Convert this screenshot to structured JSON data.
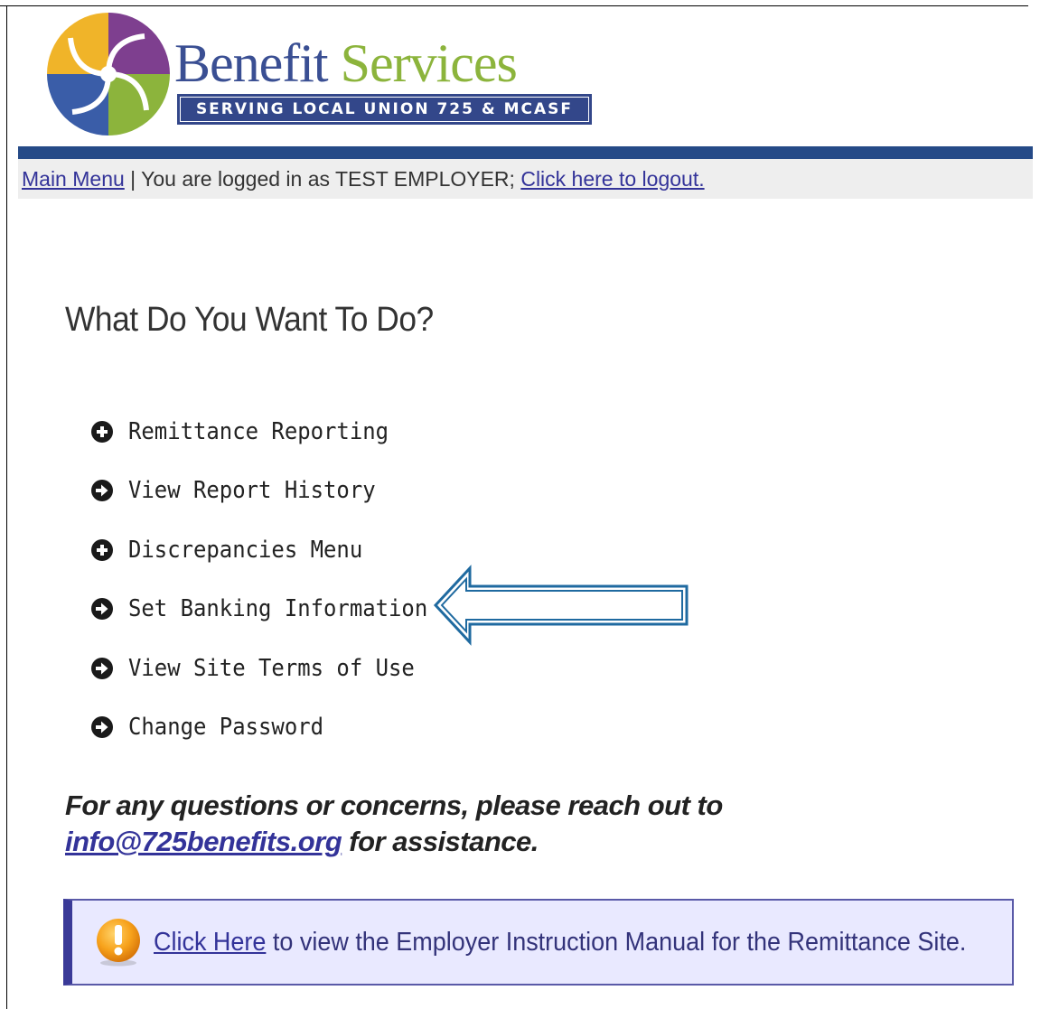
{
  "brand": {
    "name_part1": "Benefit",
    "name_part2": "Services",
    "tagline": "SERVING LOCAL UNION 725 & MCASF",
    "colors": {
      "navy": "#3a4f93",
      "green": "#8cb43c",
      "purple": "#7e3f8f",
      "gold": "#f0b429",
      "blue_bar": "#254a87"
    }
  },
  "status_bar": {
    "main_menu_link": "Main Menu",
    "separator": " | ",
    "logged_in_text": "You are logged in as TEST EMPLOYER; ",
    "logout_link": "Click here to logout."
  },
  "page": {
    "title": "What Do You Want To Do?"
  },
  "menu": [
    {
      "label": "Remittance Reporting",
      "icon": "plus-circle-icon"
    },
    {
      "label": "View Report History",
      "icon": "arrow-circle-right-icon"
    },
    {
      "label": "Discrepancies Menu",
      "icon": "plus-circle-icon"
    },
    {
      "label": "Set Banking Information",
      "icon": "arrow-circle-right-icon"
    },
    {
      "label": "View Site Terms of Use",
      "icon": "arrow-circle-right-icon"
    },
    {
      "label": "Change Password",
      "icon": "arrow-circle-right-icon"
    }
  ],
  "help": {
    "prefix": "For any questions or concerns, please reach out to ",
    "email": "info@725benefits.org",
    "suffix": " for assistance."
  },
  "notice": {
    "icon": "warning-exclamation-icon",
    "link": "Click Here",
    "text": " to view the Employer Instruction Manual for the Remittance Site."
  },
  "annotation": {
    "icon": "callout-arrow-left-icon"
  }
}
